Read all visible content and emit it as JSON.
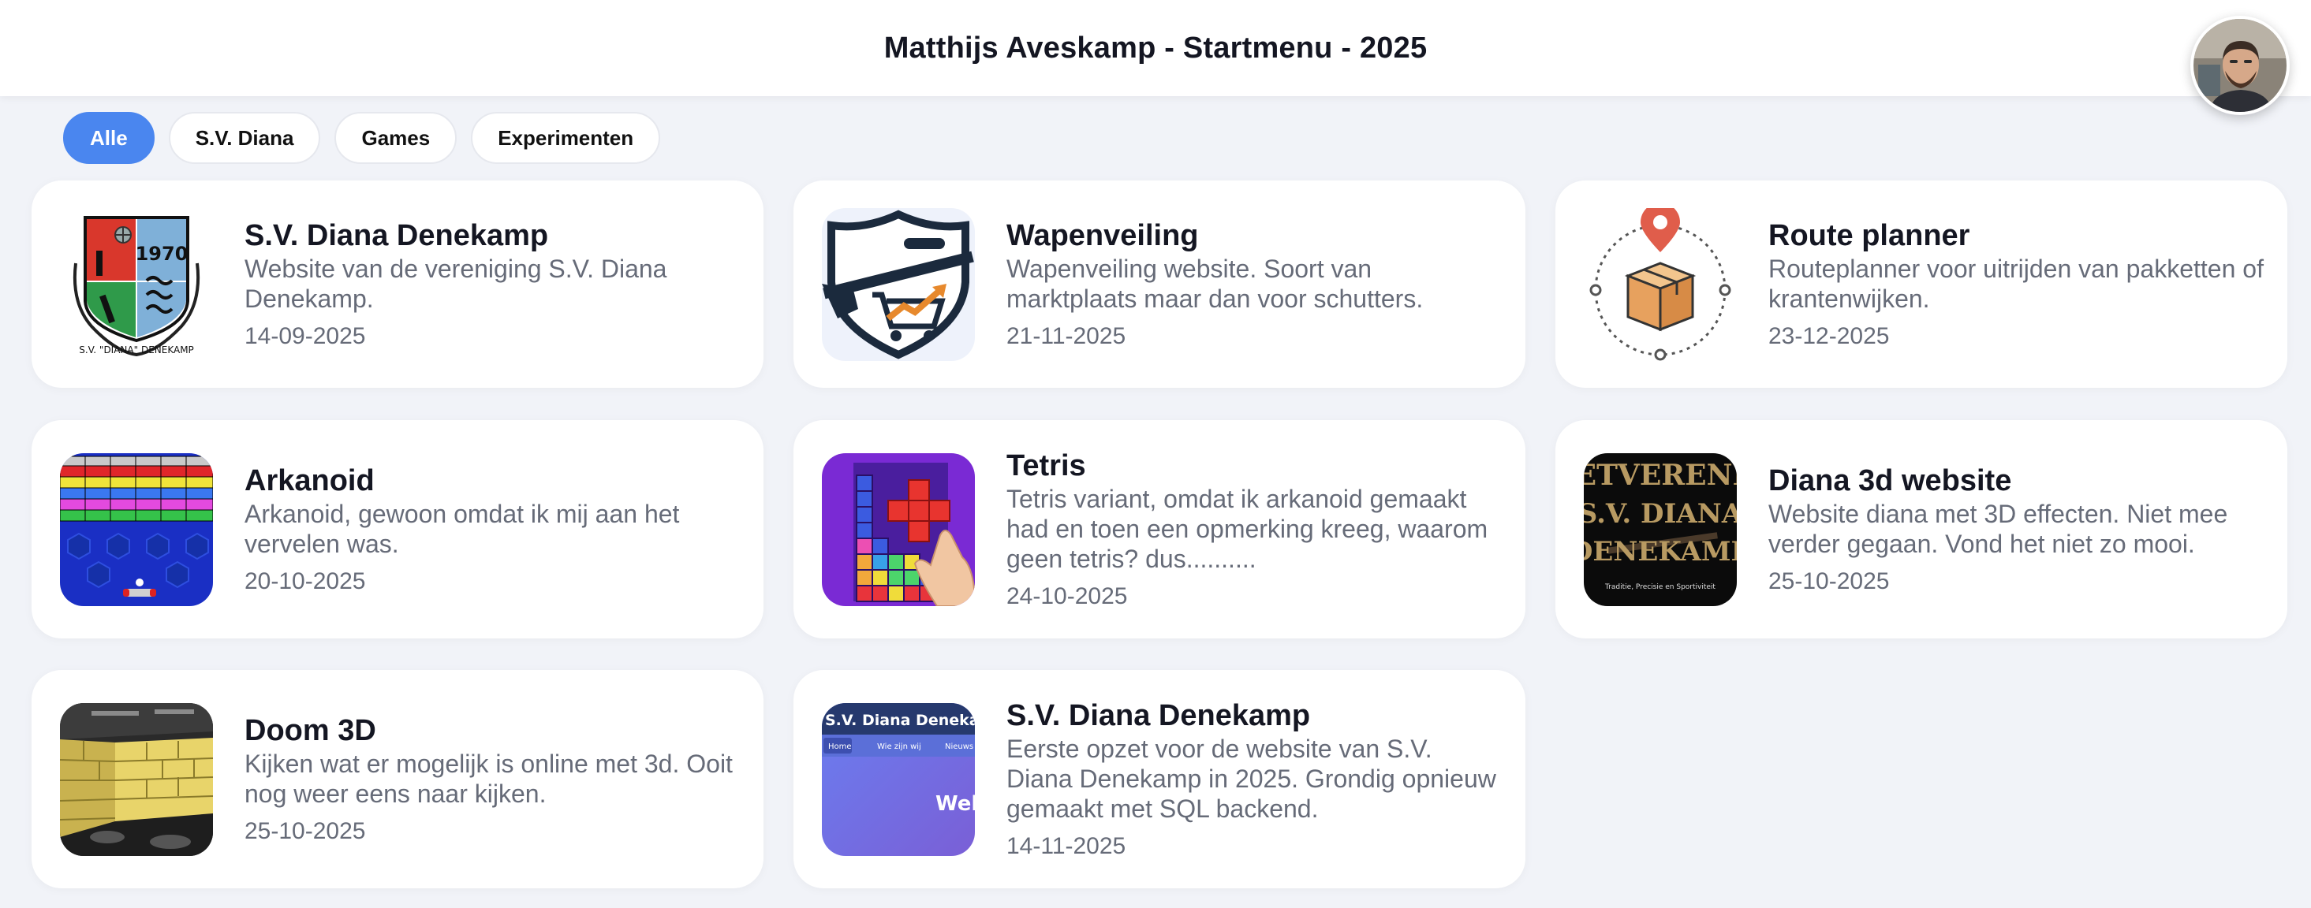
{
  "header": {
    "title": "Matthijs Aveskamp - Startmenu - 2025"
  },
  "filters": [
    "Alle",
    "S.V. Diana",
    "Games",
    "Experimenten"
  ],
  "active_filter": "Alle",
  "cards": [
    {
      "title": "S.V. Diana Denekamp",
      "desc": "Website van de vereniging S.V. Diana Denekamp.",
      "date": "14-09-2025",
      "icon": "club-crest-icon",
      "thumb_text": [
        "1970",
        "S.V. \"DIANA\" DENEKAMP"
      ]
    },
    {
      "title": "Wapenveiling",
      "desc": "Wapenveiling website. Soort van marktplaats maar dan voor schutters.",
      "date": "21-11-2025",
      "icon": "rifle-shield-cart-icon"
    },
    {
      "title": "Route planner",
      "desc": "Routeplanner voor uitrijden van pakketten of krantenwijken.",
      "date": "23-12-2025",
      "icon": "map-pin-package-icon"
    },
    {
      "title": "Arkanoid",
      "desc": "Arkanoid, gewoon omdat ik mij aan het vervelen was.",
      "date": "20-10-2025",
      "icon": "arkanoid-game-icon"
    },
    {
      "title": "Tetris",
      "desc": "Tetris variant, omdat ik arkanoid gemaakt had en toen een opmerking kreeg, waarom geen tetris? dus..........",
      "date": "24-10-2025",
      "icon": "tetris-game-icon"
    },
    {
      "title": "Diana 3d website",
      "desc": "Website diana met 3D effecten. Niet mee verder gegaan. Vond het niet zo mooi.",
      "date": "25-10-2025",
      "icon": "diana-3d-preview-icon",
      "thumb_text": [
        "ETVERENI",
        "S.V. DIANA",
        "DENEKAMP",
        "Traditie, Precisie en Sportiviteit"
      ]
    },
    {
      "title": "Doom 3D",
      "desc": "Kijken wat er mogelijk is online met 3d. Ooit nog weer eens naar kijken.",
      "date": "25-10-2025",
      "icon": "doom-3d-preview-icon"
    },
    {
      "title": "S.V. Diana Denekamp",
      "desc": "Eerste opzet voor de website van S.V. Diana Denekamp in 2025. Grondig opnieuw gemaakt met SQL backend.",
      "date": "14-11-2025",
      "icon": "website-preview-icon",
      "thumb_text": [
        "S.V. Diana Denekamp",
        "Home",
        "Wie zijn wij",
        "Nieuws",
        "Wel"
      ]
    }
  ],
  "colors": {
    "accent": "#4a86ef",
    "background": "#f1f3f8",
    "card": "#ffffff",
    "muted_text": "#666b78"
  }
}
